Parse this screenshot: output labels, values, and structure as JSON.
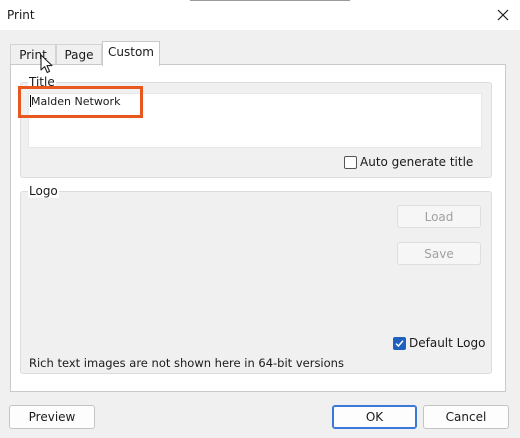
{
  "window": {
    "title": "Print",
    "close_icon": "close-icon"
  },
  "tabs": [
    {
      "label": "Print",
      "active": false
    },
    {
      "label": "Page",
      "active": false
    },
    {
      "label": "Custom",
      "active": true
    }
  ],
  "title_group": {
    "label": "Title",
    "value": "Malden Network",
    "auto_generate_label": "Auto generate title",
    "auto_generate_checked": false
  },
  "logo_group": {
    "label": "Logo",
    "load_label": "Load",
    "save_label": "Save",
    "default_logo_label": "Default Logo",
    "default_logo_checked": true,
    "note": "Rich text images are not shown here in 64-bit versions"
  },
  "footer": {
    "preview_label": "Preview",
    "ok_label": "OK",
    "cancel_label": "Cancel"
  },
  "colors": {
    "accent": "#1f5fbf",
    "highlight": "#e8581e"
  }
}
